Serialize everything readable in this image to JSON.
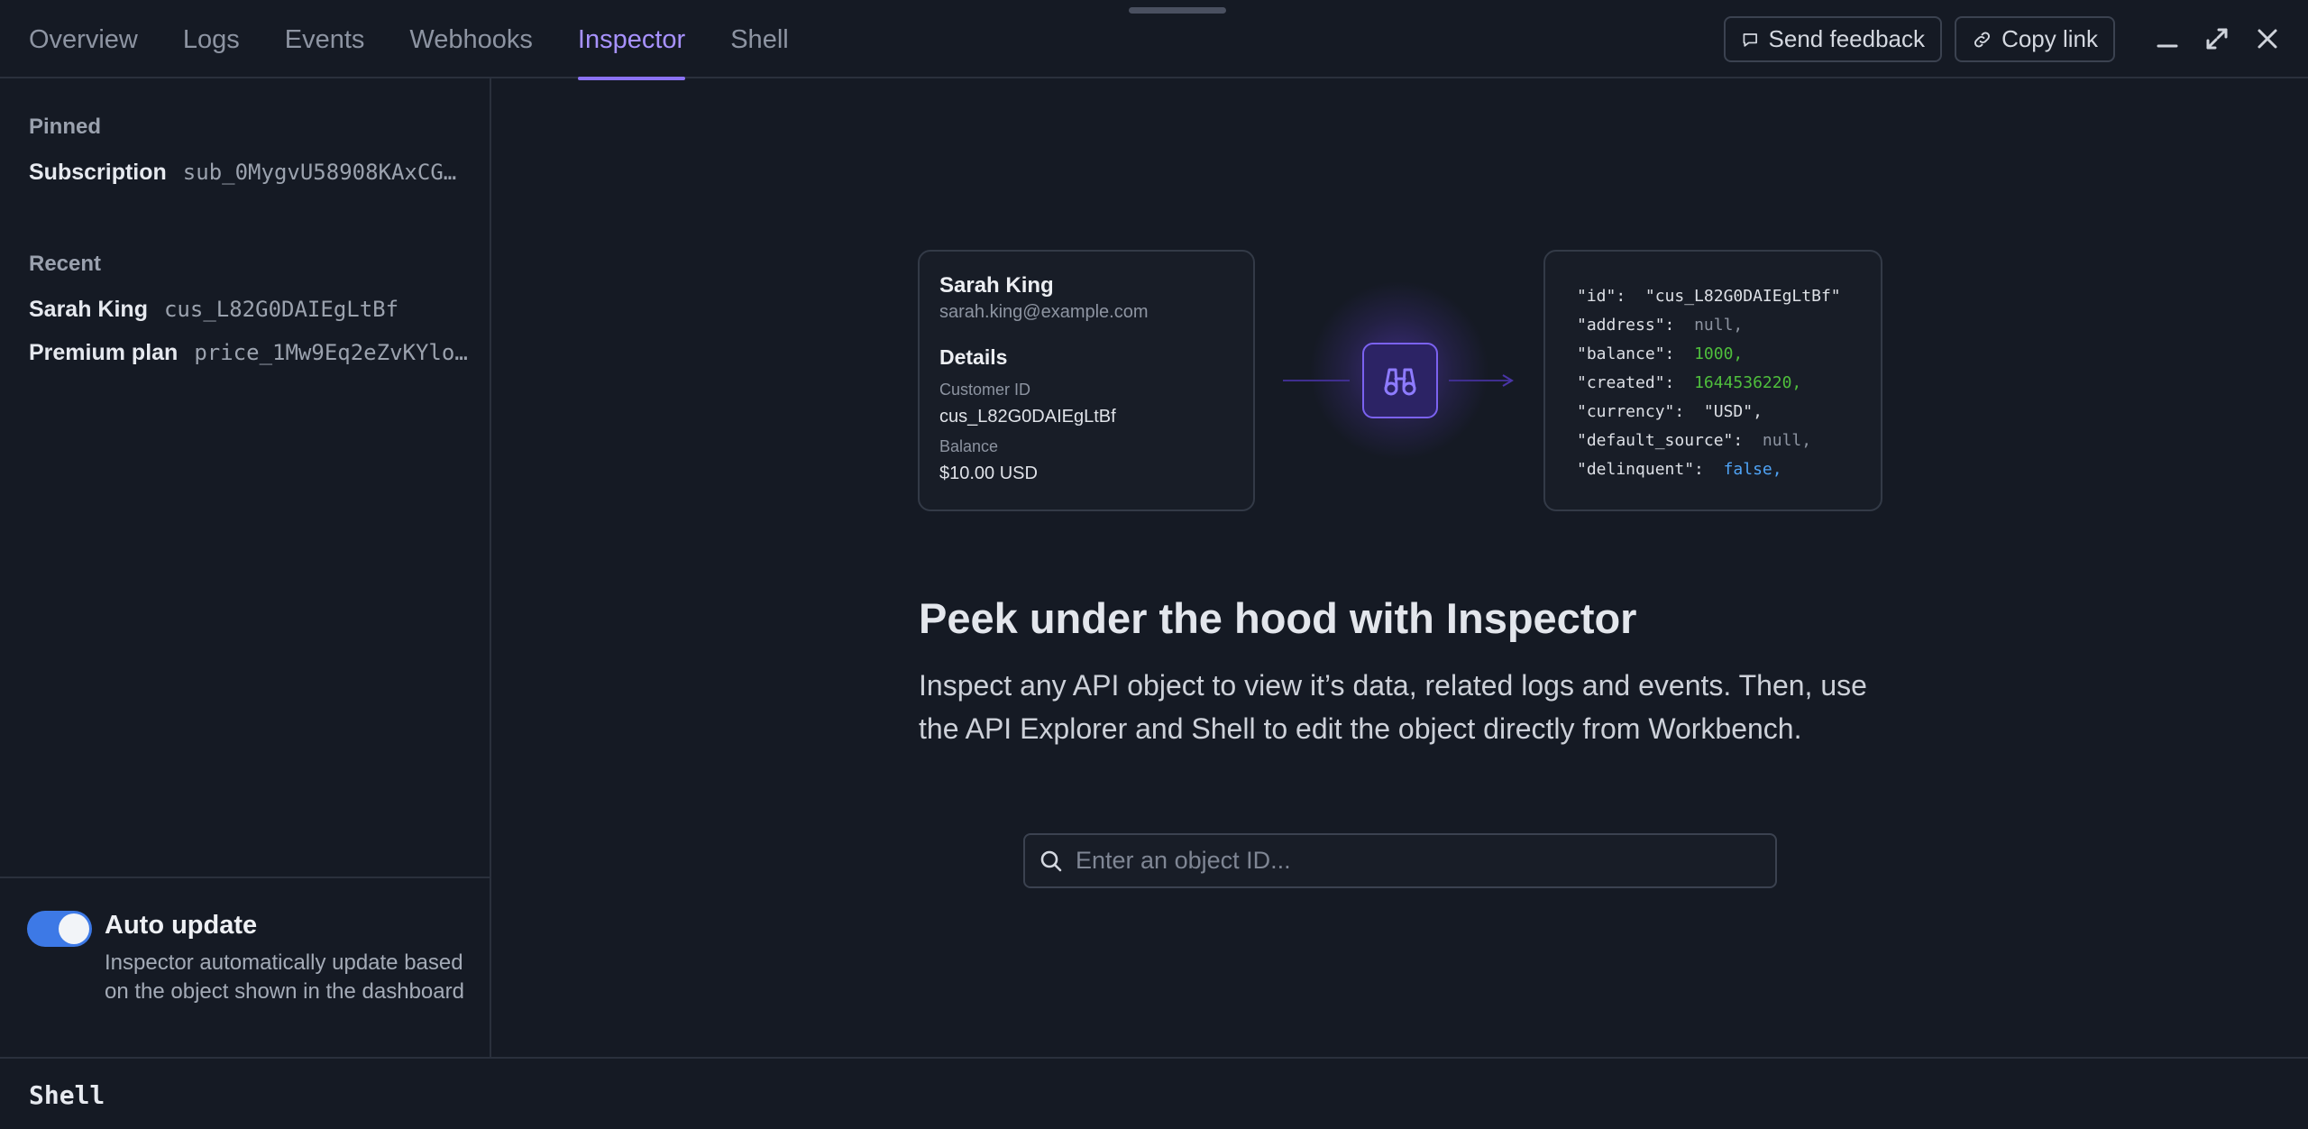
{
  "tabs": [
    {
      "label": "Overview",
      "active": false
    },
    {
      "label": "Logs",
      "active": false
    },
    {
      "label": "Events",
      "active": false
    },
    {
      "label": "Webhooks",
      "active": false
    },
    {
      "label": "Inspector",
      "active": true
    },
    {
      "label": "Shell",
      "active": false
    }
  ],
  "toolbar": {
    "feedback_label": "Send feedback",
    "copy_link_label": "Copy link",
    "icons": {
      "feedback": "speech-bubble-icon",
      "link": "link-icon",
      "minimize": "minimize-icon",
      "expand": "expand-icon",
      "close": "close-icon"
    }
  },
  "sidebar": {
    "pinned_title": "Pinned",
    "pinned": [
      {
        "label": "Subscription",
        "value": "sub_0MygvU58908KAxCG…"
      }
    ],
    "recent_title": "Recent",
    "recent": [
      {
        "label": "Sarah King",
        "value": "cus_L82G0DAIEgLtBf"
      },
      {
        "label": "Premium plan",
        "value": "price_1Mw9Eq2eZvKYlo…"
      }
    ],
    "auto_update": {
      "enabled": true,
      "title": "Auto update",
      "description": "Inspector automatically update based on the object shown in the dashboard"
    }
  },
  "illustration": {
    "customer": {
      "name": "Sarah King",
      "email": "sarah.king@example.com",
      "details_title": "Details",
      "customer_id_label": "Customer ID",
      "customer_id": "cus_L82G0DAIEgLtBf",
      "balance_label": "Balance",
      "balance": "$10.00 USD"
    },
    "center_icon": "binoculars-icon",
    "json": [
      {
        "key": "\"id\":",
        "value": "\"cus_L82G0DAIEgLtBf\"",
        "kind": "str"
      },
      {
        "key": "\"address\":",
        "value": "null,",
        "kind": "null"
      },
      {
        "key": "\"balance\":",
        "value": "1000,",
        "kind": "num"
      },
      {
        "key": "\"created\":",
        "value": "1644536220,",
        "kind": "num"
      },
      {
        "key": "\"currency\":",
        "value": "\"USD\",",
        "kind": "str"
      },
      {
        "key": "\"default_source\":",
        "value": "null,",
        "kind": "null"
      },
      {
        "key": "\"delinquent\":",
        "value": "false,",
        "kind": "bool"
      }
    ]
  },
  "hero": {
    "title": "Peek under the hood with Inspector",
    "description": "Inspect any API object to view it’s data, related logs and events. Then, use the API Explorer and Shell to edit the object directly from Workbench."
  },
  "search": {
    "placeholder": "Enter an object ID...",
    "value": ""
  },
  "shell": {
    "label": "Shell"
  },
  "colors": {
    "background": "#151a24",
    "accent": "#a892ff",
    "toggle_on": "#3d79e6",
    "json_number": "#4fbf3c",
    "json_bool": "#4fa3f5"
  }
}
